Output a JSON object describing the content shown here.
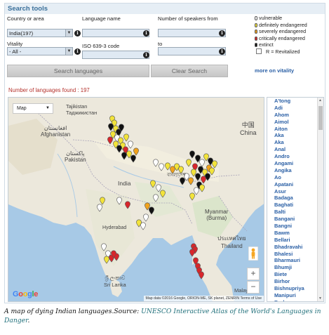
{
  "panel_title": "Search tools",
  "form": {
    "country_label": "Country or area",
    "country_value": "India(197)",
    "language_label": "Language name",
    "language_value": "",
    "speakers_label": "Number of speakers from",
    "speakers_from_value": "",
    "to_label": "to",
    "speakers_to_value": "",
    "vitality_label": "Vitality",
    "vitality_value": "- All -",
    "iso_label": "ISO 639-3 code",
    "iso_value": "",
    "info_glyph": "i"
  },
  "buttons": {
    "search": "Search languages",
    "clear": "Clear Search"
  },
  "result_text": "Number of languages found : 197",
  "legend": {
    "items": [
      {
        "label": "vulnerable",
        "color": "#ffffff"
      },
      {
        "label": "definitely endangered",
        "color": "#f2e33a"
      },
      {
        "label": "severely endangered",
        "color": "#f0a21c"
      },
      {
        "label": "critically endangered",
        "color": "#d8262b"
      },
      {
        "label": "extinct",
        "color": "#111111"
      }
    ],
    "revitalized_label": "R = Revitalized",
    "more_link": "more on vitality"
  },
  "map": {
    "type_selector": "Map",
    "zoom_in": "+",
    "zoom_out": "−",
    "logo": "Google",
    "attribution": "Map data ©2016 Google, ORION-ME, SK planet, ZENRIN  Terms of Use",
    "labels": {
      "tajikistan": "Tajikistan",
      "tajikistan_native": "Таджикистан",
      "afghanistan_native": "افغانستان",
      "afghanistan": "Afghanistan",
      "pakistan_native": "پاکستان",
      "pakistan": "Pakistan",
      "china_native": "中国",
      "china": "China",
      "india": "India",
      "bangladesh_native": "বাংলাদেশ",
      "myanmar": "Myanmar",
      "burma": "(Burma)",
      "thailand_native": "ประเทศไทย",
      "thailand": "Thailand",
      "hyderabad": "Hyderabad",
      "sri_lanka_native": "ශ්‍රී ලංකාව",
      "sri_lanka": "Sri Lanka",
      "malaysia": "Malaysia"
    },
    "pin_colors": {
      "white": "#ffffff",
      "yellow": "#f2e33a",
      "orange": "#f0a21c",
      "red": "#d8262b",
      "black": "#111111"
    }
  },
  "language_list": [
    "A'tong",
    "Adi",
    "Ahom",
    "Aimol",
    "Aiton",
    "Aka",
    "Aka",
    "Anal",
    "Andro",
    "Angami",
    "Angika",
    "Ao",
    "Apatani",
    "Asur",
    "Badaga",
    "Baghati",
    "Balti",
    "Bangani",
    "Bangni",
    "Bawm",
    "Bellari",
    "Bhadravahi",
    "Bhalesi",
    "Bharmauri",
    "Bhumji",
    "Biete",
    "Birhor",
    "Bishnupriya",
    "Manipuri",
    "Bodo"
  ],
  "caption": {
    "text": "A map of dying Indian languages.Source: ",
    "link": "UNESCO Interactive Atlas of the World's Languages in Danger",
    "end": "."
  }
}
